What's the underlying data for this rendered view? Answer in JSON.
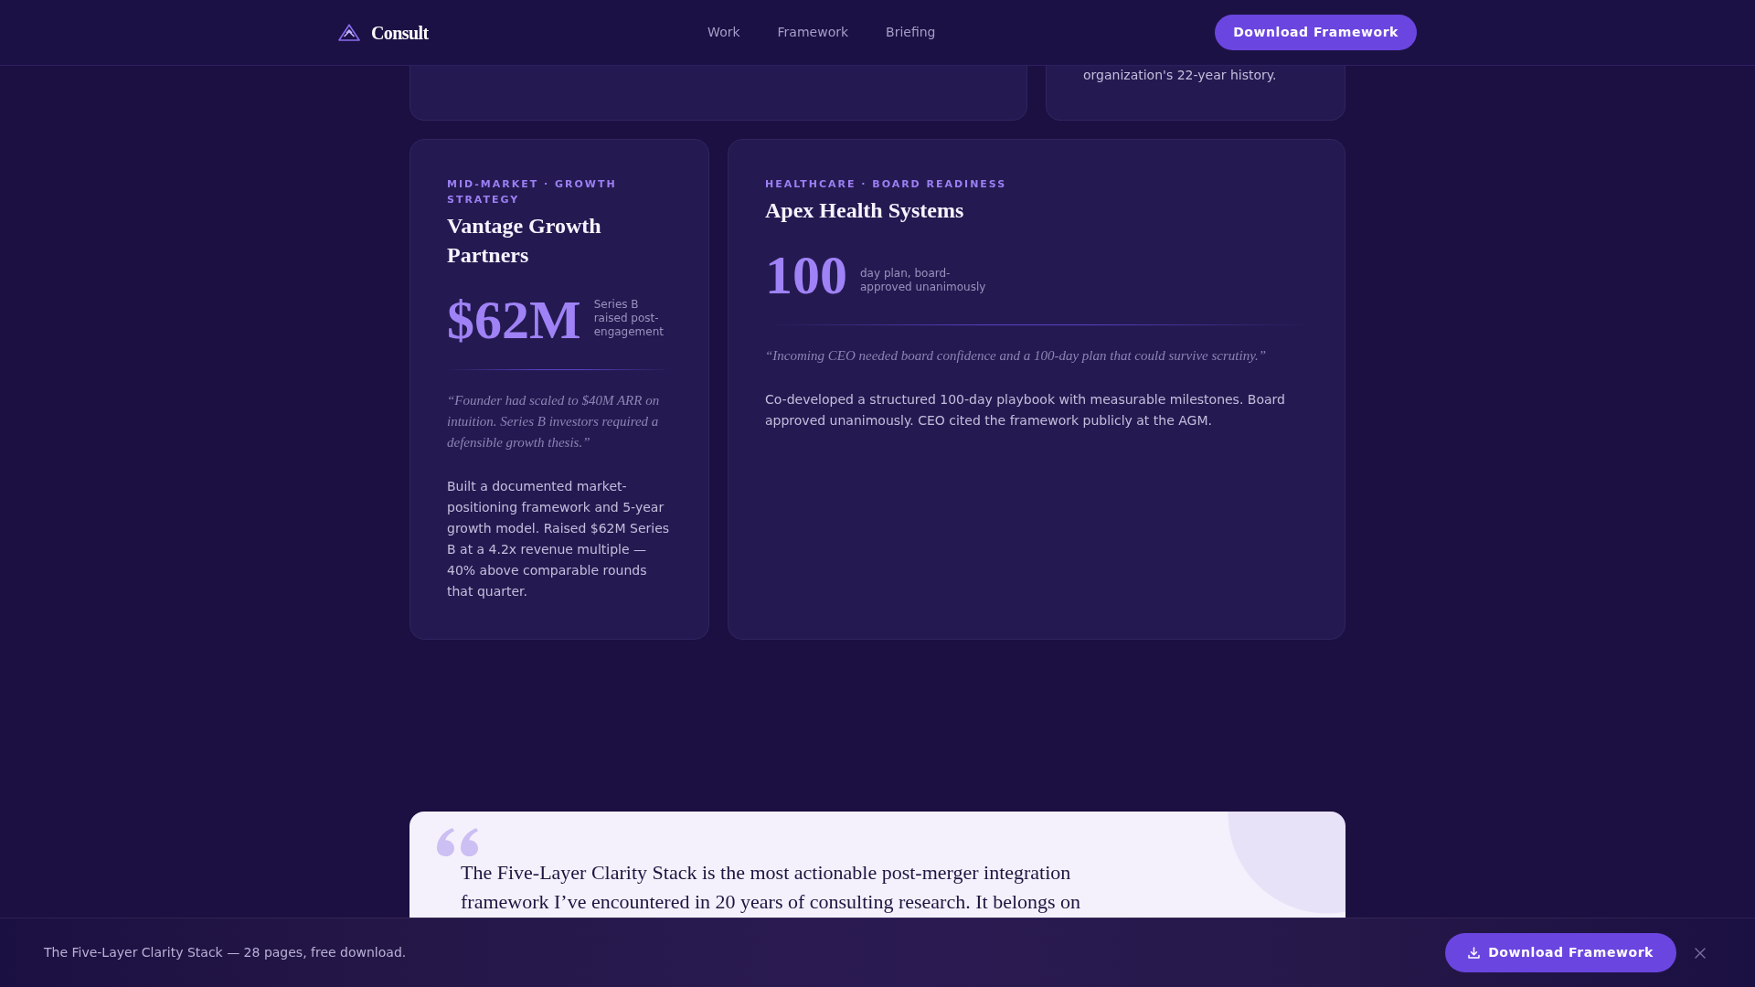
{
  "navbar": {
    "brand": "Consult",
    "links": [
      {
        "label": "Work",
        "selected": false
      },
      {
        "label": "Framework",
        "selected": false
      },
      {
        "label": "Briefing",
        "selected": false
      }
    ],
    "cta": "Download Framework"
  },
  "previous_row": [
    {
      "kind": "blank"
    },
    {
      "kind": "text",
      "body": "organization's 22-year history."
    }
  ],
  "case_studies": [
    {
      "label": "MID-MARKET · GROWTH STRATEGY",
      "title": "Vantage Growth Partners",
      "stat": "$62M",
      "stat_caption": "Series B raised post-engagement",
      "quote": "“Founder had scaled to $40M ARR on intuition. Series B investors required a defensible growth thesis.”",
      "body": "Built a documented market-positioning framework and 5-year growth model. Raised $62M Series B at a 4.2x revenue multiple — 40% above comparable rounds that quarter."
    },
    {
      "label": "HEALTHCARE · BOARD READINESS",
      "title": "Apex Health Systems",
      "stat": "100",
      "stat_caption": "day plan, board-approved unanimously",
      "quote": "“Incoming CEO needed board confidence and a 100-day plan that could survive scrutiny.”",
      "body": "Co-developed a structured 100-day playbook with measurable milestones. Board approved unanimously. CEO cited the framework publicly at the AGM."
    }
  ],
  "testimonial": {
    "quote": "The Five-Layer Clarity Stack is the most actionable post-merger integration framework I’ve encountered in 20 years of consulting research. It belongs on"
  },
  "download_bar": {
    "text": "The Five-Layer Clarity Stack — 28 pages, free download.",
    "button": "Download Framework"
  }
}
